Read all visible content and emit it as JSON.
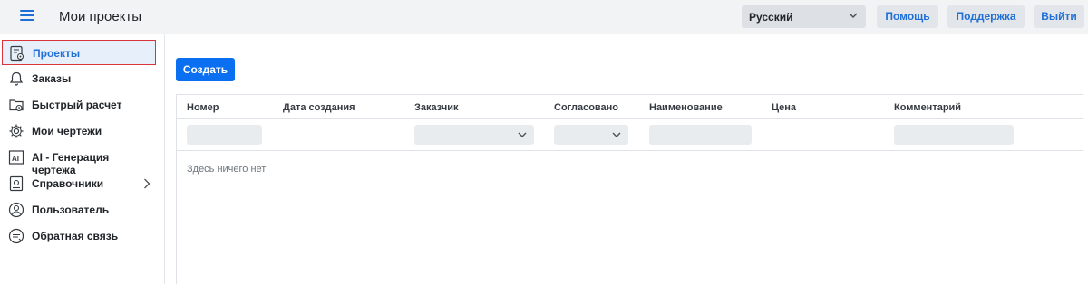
{
  "header": {
    "title": "Мои проекты",
    "language": "Русский",
    "help_label": "Помощь",
    "support_label": "Поддержка",
    "logout_label": "Выйти"
  },
  "sidebar": {
    "items": [
      {
        "label": "Проекты",
        "icon": "projects-icon",
        "active": true
      },
      {
        "label": "Заказы",
        "icon": "bell-icon"
      },
      {
        "label": "Быстрый расчет",
        "icon": "quick-calc-icon"
      },
      {
        "label": "Мои чертежи",
        "icon": "gear-icon"
      },
      {
        "label": "AI - Генерация чертежа",
        "icon": "ai-icon"
      },
      {
        "label": "Справочники",
        "icon": "handbook-icon",
        "has_submenu": true
      },
      {
        "label": "Пользователь",
        "icon": "user-icon"
      },
      {
        "label": "Обратная связь",
        "icon": "feedback-icon"
      }
    ]
  },
  "main": {
    "create_label": "Создать",
    "columns": [
      "Номер",
      "Дата создания",
      "Заказчик",
      "Согласовано",
      "Наименование",
      "Цена",
      "Комментарий"
    ],
    "empty_text": "Здесь ничего нет"
  },
  "colors": {
    "accent": "#1f6fd6",
    "primary_button": "#0b6ff2",
    "active_border": "#d9343a",
    "active_bg": "#e6effa"
  }
}
